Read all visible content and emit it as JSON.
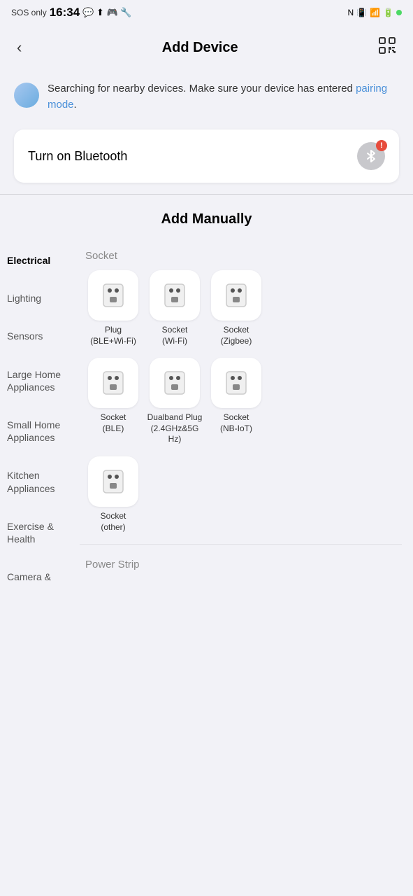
{
  "statusBar": {
    "left": "SOS only",
    "time": "16:34",
    "icons": [
      "message",
      "upload",
      "game",
      "tool"
    ]
  },
  "header": {
    "title": "Add Device",
    "backLabel": "‹",
    "scanLabel": "⛶"
  },
  "searchNotice": {
    "text": "Searching for nearby devices. Make sure your device has entered ",
    "linkText": "pairing mode",
    "suffix": "."
  },
  "bluetooth": {
    "label": "Turn on Bluetooth",
    "alertSymbol": "!"
  },
  "addManually": {
    "title": "Add Manually"
  },
  "sidebar": {
    "items": [
      {
        "id": "electrical",
        "label": "Electrical",
        "active": true
      },
      {
        "id": "lighting",
        "label": "Lighting",
        "active": false
      },
      {
        "id": "sensors",
        "label": "Sensors",
        "active": false
      },
      {
        "id": "large-home",
        "label": "Large Home Appliances",
        "active": false
      },
      {
        "id": "small-home",
        "label": "Small Home Appliances",
        "active": false
      },
      {
        "id": "kitchen",
        "label": "Kitchen Appliances",
        "active": false
      },
      {
        "id": "exercise",
        "label": "Exercise & Health",
        "active": false
      },
      {
        "id": "camera",
        "label": "Camera &",
        "active": false
      }
    ]
  },
  "sections": [
    {
      "label": "Socket",
      "devices": [
        {
          "id": "plug-ble-wifi",
          "label": "Plug\n(BLE+Wi-Fi)"
        },
        {
          "id": "socket-wifi",
          "label": "Socket\n(Wi-Fi)"
        },
        {
          "id": "socket-zigbee",
          "label": "Socket\n(Zigbee)"
        },
        {
          "id": "socket-ble",
          "label": "Socket\n(BLE)"
        },
        {
          "id": "dualband-plug",
          "label": "Dualband Plug\n(2.4GHz&5G Hz)"
        },
        {
          "id": "socket-nb-iot",
          "label": "Socket\n(NB-IoT)"
        },
        {
          "id": "socket-other",
          "label": "Socket\n(other)"
        }
      ]
    },
    {
      "label": "Power Strip",
      "devices": []
    }
  ]
}
